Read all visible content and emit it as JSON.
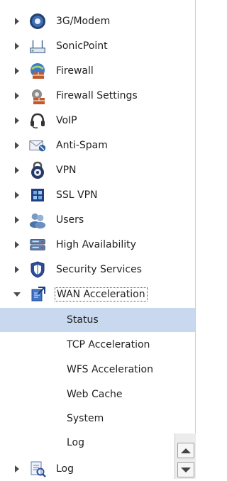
{
  "nav": {
    "items_top": [
      {
        "label": "3G/Modem",
        "icon": "modem-icon"
      },
      {
        "label": "SonicPoint",
        "icon": "access-point-icon"
      },
      {
        "label": "Firewall",
        "icon": "firewall-icon"
      },
      {
        "label": "Firewall Settings",
        "icon": "firewall-settings-icon"
      },
      {
        "label": "VoIP",
        "icon": "headset-icon"
      },
      {
        "label": "Anti-Spam",
        "icon": "mail-icon"
      },
      {
        "label": "VPN",
        "icon": "lock-icon"
      },
      {
        "label": "SSL VPN",
        "icon": "ssl-vpn-icon"
      },
      {
        "label": "Users",
        "icon": "users-icon"
      },
      {
        "label": "High Availability",
        "icon": "servers-icon"
      },
      {
        "label": "Security Services",
        "icon": "shield-icon"
      }
    ],
    "expanded": {
      "label": "WAN Acceleration",
      "icon": "wan-acceleration-icon",
      "children": [
        "Status",
        "TCP Acceleration",
        "WFS Acceleration",
        "Web Cache",
        "System",
        "Log"
      ],
      "selected": "Status"
    },
    "items_bottom": [
      {
        "label": "Log",
        "icon": "log-icon"
      }
    ]
  },
  "colors": {
    "selection": "#c8d8ee",
    "caret": "#4a4a4a"
  }
}
